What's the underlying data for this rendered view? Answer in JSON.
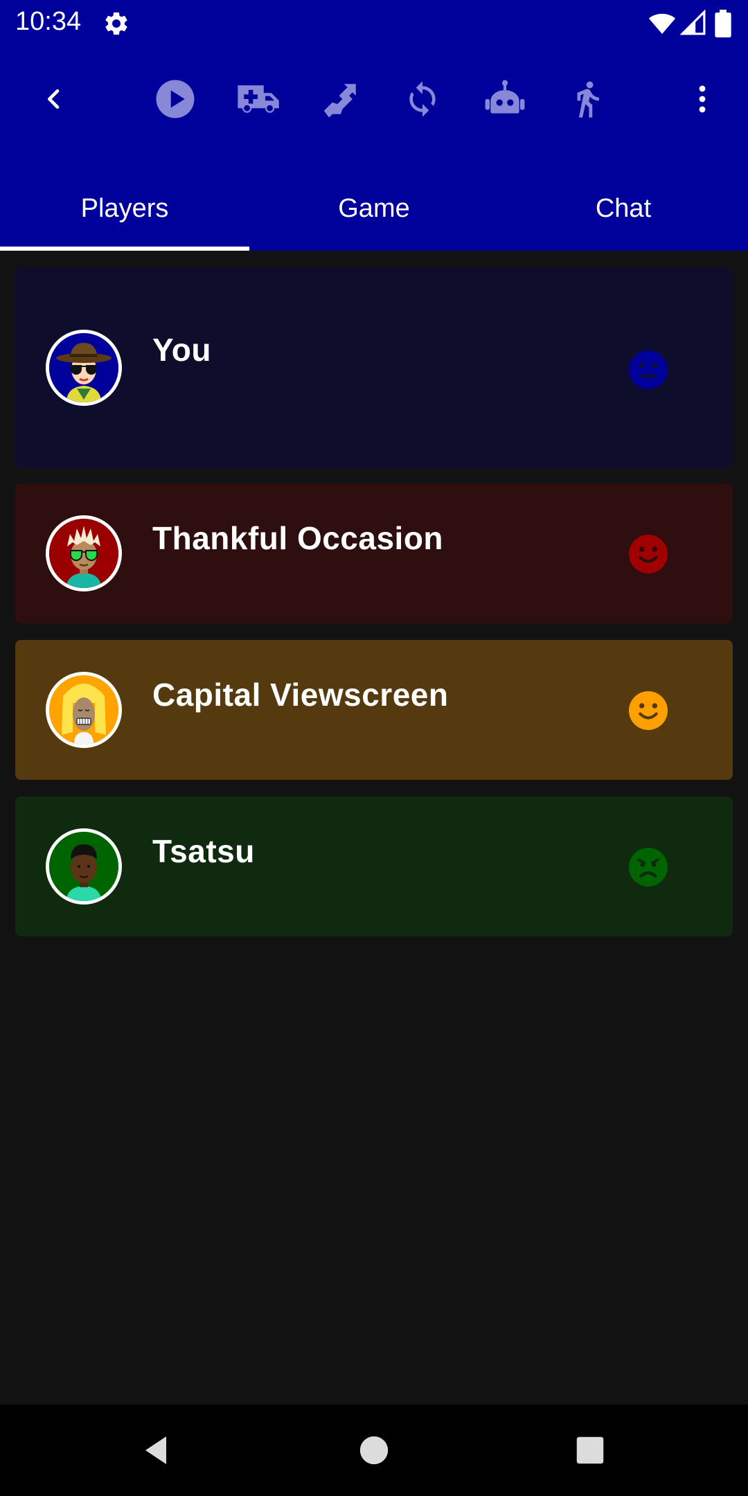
{
  "status_bar": {
    "time": "10:34"
  },
  "tabs": [
    {
      "label": "Players",
      "selected": true
    },
    {
      "label": "Game",
      "selected": false
    },
    {
      "label": "Chat",
      "selected": false
    }
  ],
  "toolbar": {
    "icons": [
      "back-arrow-icon",
      "play-icon",
      "ambulance-icon",
      "transfer-icon",
      "sync-icon",
      "robot-icon",
      "walk-icon",
      "more-vert-icon"
    ]
  },
  "players": [
    {
      "name": "You",
      "mood": "neutral",
      "mood_color": "#00009b",
      "card_color": "#0e0e2c",
      "avatar_bg": "#00009b"
    },
    {
      "name": "Thankful Occasion",
      "mood": "happy",
      "mood_color": "#a00000",
      "card_color": "#2e0e0e",
      "avatar_bg": "#9b0000"
    },
    {
      "name": "Capital Viewscreen",
      "mood": "happy",
      "mood_color": "#ff9f00",
      "card_color": "#553a10",
      "avatar_bg": "#ffa300"
    },
    {
      "name": "Tsatsu",
      "mood": "sad",
      "mood_color": "#006400",
      "card_color": "#0f2a0f",
      "avatar_bg": "#006400"
    }
  ],
  "colors": {
    "app_bar": "#00009b",
    "background": "#121212",
    "toolbar_icon": "#8888d8"
  }
}
